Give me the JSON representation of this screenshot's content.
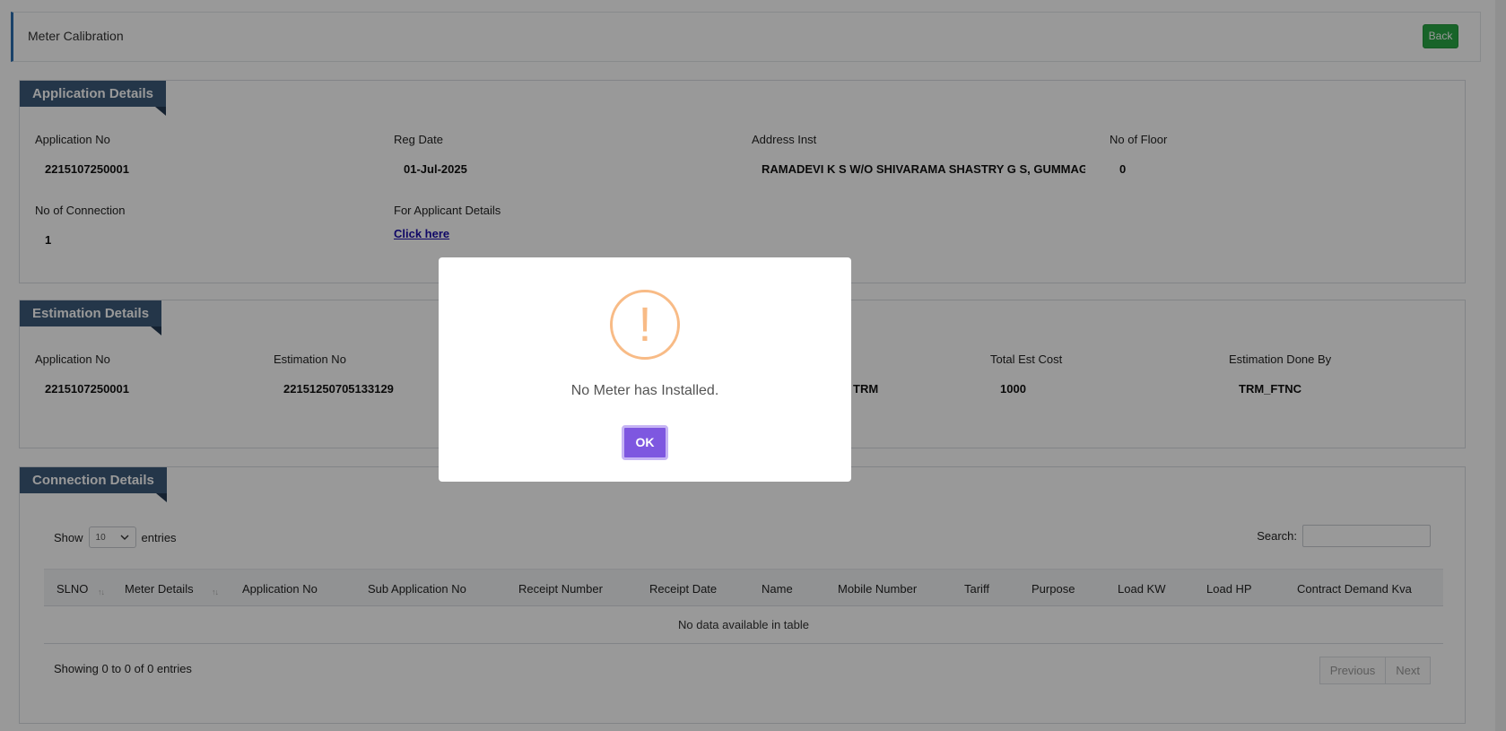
{
  "header": {
    "title": "Meter Calibration",
    "back_label": "Back"
  },
  "application_details": {
    "heading": "Application Details",
    "fields": {
      "application_no": {
        "label": "Application No",
        "value": "2215107250001"
      },
      "reg_date": {
        "label": "Reg Date",
        "value": "01-Jul-2025"
      },
      "address_inst": {
        "label": "Address Inst",
        "value": "RAMADEVI K S  W/O SHIVARAMA SHASTRY G S, GUMMAGHATTA"
      },
      "no_of_floor": {
        "label": "No of Floor",
        "value": "0"
      },
      "no_of_connection": {
        "label": "No of Connection",
        "value": "1"
      },
      "applicant_details": {
        "label": "For Applicant Details",
        "link": "Click here"
      }
    }
  },
  "estimation_details": {
    "heading": "Estimation Details",
    "fields": {
      "application_no": {
        "label": "Application No",
        "value": "2215107250001"
      },
      "estimation_no": {
        "label": "Estimation No",
        "value": "22151250705133129"
      },
      "partial_value": "TRM",
      "total_est_cost": {
        "label": "Total Est Cost",
        "value": "1000"
      },
      "estimation_done_by": {
        "label": "Estimation Done By",
        "value": "TRM_FTNC"
      }
    }
  },
  "connection_details": {
    "heading": "Connection Details",
    "show_label": "Show",
    "entries_label": "entries",
    "page_length": "10",
    "search_label": "Search:",
    "columns": [
      "SLNO",
      "Meter Details",
      "Application No",
      "Sub Application No",
      "Receipt Number",
      "Receipt Date",
      "Name",
      "Mobile Number",
      "Tariff",
      "Purpose",
      "Load KW",
      "Load HP",
      "Contract Demand Kva"
    ],
    "empty_message": "No data available in table",
    "info": "Showing 0 to 0 of 0 entries",
    "prev_label": "Previous",
    "next_label": "Next"
  },
  "modal": {
    "icon_glyph": "!",
    "message": "No Meter has Installed.",
    "ok_label": "OK"
  },
  "colors": {
    "accent": "#7e57e0",
    "warning": "#f8bb86",
    "panel_tag": "#3d5a7a",
    "back_button": "#28a745"
  }
}
